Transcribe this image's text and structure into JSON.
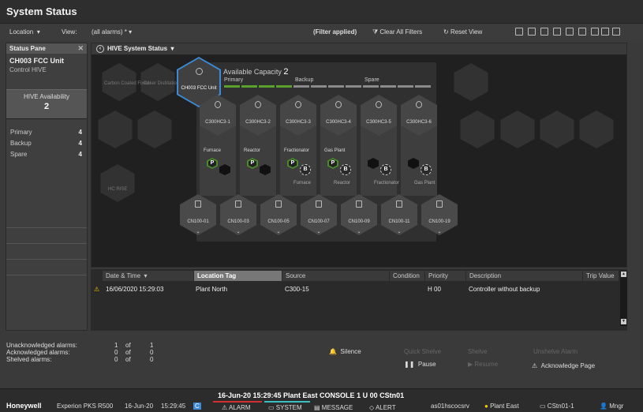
{
  "title": "System Status",
  "toolbar": {
    "location_label": "Location",
    "view_label": "View:",
    "view_value": "(all alarms) *",
    "filter_applied": "(Filter applied)",
    "clear_filters": "Clear All Filters",
    "reset_view": "Reset View"
  },
  "status_pane": {
    "header": "Status Pane",
    "unit": "CH003 FCC Unit",
    "sub": "Control HIVE",
    "availability_label": "HIVE Availability",
    "availability_value": "2",
    "rows": [
      {
        "label": "Primary",
        "value": "4"
      },
      {
        "label": "Backup",
        "value": "4"
      },
      {
        "label": "Spare",
        "value": "4"
      }
    ]
  },
  "hive": {
    "header": "HIVE System Status",
    "fcc_label": "CH003 FCC Unit",
    "capacity_label": "Available Capacity",
    "capacity_value": "2",
    "segments": {
      "primary": "Primary",
      "backup": "Backup",
      "spare": "Spare"
    },
    "controllers": [
      {
        "name": "C300HC3-1",
        "slot": "Furnace",
        "badge": "P",
        "sub": ""
      },
      {
        "name": "C300HC3-2",
        "slot": "Reactor",
        "badge": "P",
        "sub": ""
      },
      {
        "name": "C300HC3-3",
        "slot": "Fractionator",
        "badge": "P",
        "sub": "Furnace"
      },
      {
        "name": "C300HC3-4",
        "slot": "Gas Plant",
        "badge": "P",
        "sub": "Reactor"
      },
      {
        "name": "C300HC3-5",
        "slot": "",
        "badge": "B",
        "sub": "Fractionator"
      },
      {
        "name": "C300HC3-6",
        "slot": "",
        "badge": "B",
        "sub": "Gas Plant"
      }
    ],
    "second_badge": "B",
    "cn": [
      "CN100-01",
      "CN100-03",
      "CN100-05",
      "CN100-07",
      "CN100-09",
      "CN100-11",
      "CN100-19"
    ],
    "bg_labels": [
      "Carbon Coated Fixed",
      "Coker Distillation",
      "HC RISE"
    ]
  },
  "alarms": {
    "headers": [
      "Date & Time",
      "Location Tag",
      "Source",
      "Condition",
      "Priority",
      "Description",
      "Trip Value"
    ],
    "rows": [
      {
        "datetime": "16/06/2020 15:29:03",
        "location": "Plant North",
        "source": "C300-15",
        "condition": "",
        "priority": "H 00",
        "description": "Controller without backup",
        "trip": ""
      }
    ]
  },
  "counts": [
    {
      "label": "Unacknowledged alarms:",
      "a": "1",
      "of": "of",
      "b": "1"
    },
    {
      "label": "Acknowledged alarms:",
      "a": "0",
      "of": "of",
      "b": "0"
    },
    {
      "label": "Shelved alarms:",
      "a": "0",
      "of": "of",
      "b": "0"
    }
  ],
  "actions": {
    "silence": "Silence",
    "pause": "Pause",
    "quick_shelve": "Quick Shelve",
    "shelve": "Shelve",
    "resume": "Resume",
    "unshelve": "Unshelve Alarm",
    "ack_page": "Acknowledge Page"
  },
  "statusbar": {
    "brand": "Honeywell",
    "product": "Experion PKS R500",
    "date": "16-Jun-20",
    "time": "15:29:45",
    "c": "C",
    "center": "16-Jun-20  15:29:45  Plant East  CONSOLE  1   U 00 CStn01",
    "alarm": "ALARM",
    "system": "SYSTEM",
    "message": "MESSAGE",
    "alert": "ALERT",
    "server": "as01hscocsrv",
    "area": "Plant East",
    "station": "CStn01-1",
    "user": "Mngr"
  }
}
